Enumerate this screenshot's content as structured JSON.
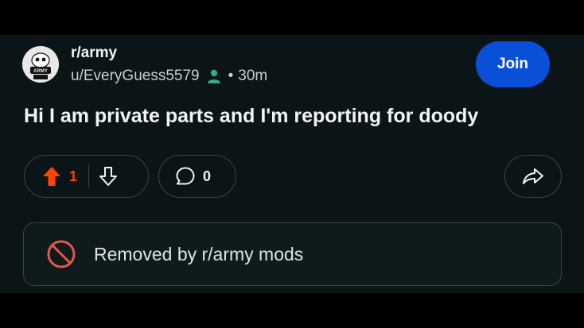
{
  "post": {
    "subreddit": "r/army",
    "username": "u/EveryGuess5579",
    "separator": "•",
    "time_ago": "30m",
    "join_label": "Join",
    "title": "Hi I am private parts and I'm reporting for doody",
    "upvotes": "1",
    "comments": "0",
    "removed_notice": "Removed by r/army mods"
  },
  "avatar": {
    "badge_text": "ARMY"
  },
  "colors": {
    "background": "#0b1416",
    "join_button": "#0a4fd8",
    "upvote_active": "#ff4500",
    "removed_icon": "#e05a4a",
    "border": "#3a4548"
  },
  "icons": [
    "snoo-avatar",
    "user-icon",
    "upvote-arrow-icon",
    "downvote-arrow-icon",
    "comment-bubble-icon",
    "share-icon",
    "ban-icon"
  ]
}
